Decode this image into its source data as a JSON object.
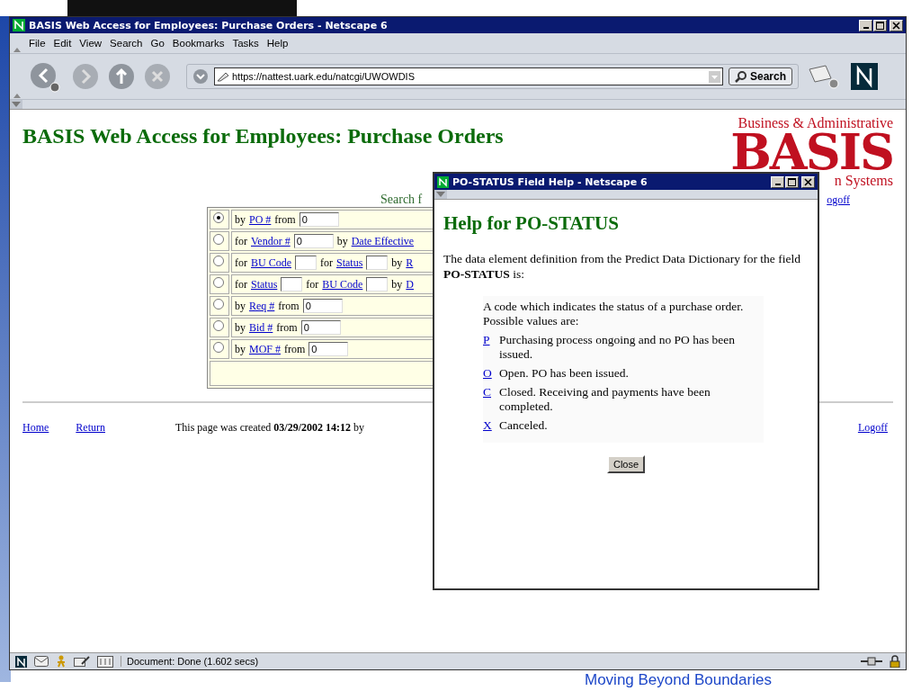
{
  "window": {
    "title": "BASIS Web Access for Employees: Purchase Orders - Netscape 6"
  },
  "menu": [
    "File",
    "Edit",
    "View",
    "Search",
    "Go",
    "Bookmarks",
    "Tasks",
    "Help"
  ],
  "toolbar": {
    "url": "https://nattest.uark.edu/natcgi/UWOWDIS",
    "search_button": "Search"
  },
  "page": {
    "heading": "BASIS Web Access for Employees: Purchase Orders",
    "logo": {
      "top": "Business & Administrative",
      "big": "BASIS",
      "bottom": "n Systems"
    },
    "search_label": "Search f",
    "logoff_top": "ogoff",
    "form_rows": [
      {
        "selected": true,
        "parts": [
          {
            "kind": "text",
            "text": "by"
          },
          {
            "kind": "link",
            "text": "PO #"
          },
          {
            "kind": "text",
            "text": "from"
          },
          {
            "kind": "input",
            "value": "0"
          }
        ]
      },
      {
        "selected": false,
        "parts": [
          {
            "kind": "text",
            "text": "for"
          },
          {
            "kind": "link",
            "text": "Vendor #"
          },
          {
            "kind": "input",
            "value": "0"
          },
          {
            "kind": "text",
            "text": "by"
          },
          {
            "kind": "link",
            "text": "Date Effective"
          }
        ]
      },
      {
        "selected": false,
        "parts": [
          {
            "kind": "text",
            "text": "for"
          },
          {
            "kind": "link",
            "text": "BU Code"
          },
          {
            "kind": "input"
          },
          {
            "kind": "text",
            "text": "for"
          },
          {
            "kind": "link",
            "text": "Status"
          },
          {
            "kind": "input"
          },
          {
            "kind": "text",
            "text": "by"
          },
          {
            "kind": "link",
            "text": "R"
          }
        ]
      },
      {
        "selected": false,
        "parts": [
          {
            "kind": "text",
            "text": "for"
          },
          {
            "kind": "link",
            "text": "Status"
          },
          {
            "kind": "input"
          },
          {
            "kind": "text",
            "text": "for"
          },
          {
            "kind": "link",
            "text": "BU Code"
          },
          {
            "kind": "input"
          },
          {
            "kind": "text",
            "text": "by"
          },
          {
            "kind": "link",
            "text": "D"
          }
        ]
      },
      {
        "selected": false,
        "parts": [
          {
            "kind": "text",
            "text": "by"
          },
          {
            "kind": "link",
            "text": "Req #"
          },
          {
            "kind": "text",
            "text": "from"
          },
          {
            "kind": "input",
            "value": "0"
          }
        ]
      },
      {
        "selected": false,
        "parts": [
          {
            "kind": "text",
            "text": "by"
          },
          {
            "kind": "link",
            "text": "Bid #"
          },
          {
            "kind": "text",
            "text": "from"
          },
          {
            "kind": "input",
            "value": "0"
          }
        ]
      },
      {
        "selected": false,
        "parts": [
          {
            "kind": "text",
            "text": "by"
          },
          {
            "kind": "link",
            "text": "MOF #"
          },
          {
            "kind": "text",
            "text": "from"
          },
          {
            "kind": "input",
            "value": "0"
          }
        ]
      }
    ],
    "footer": {
      "home": "Home",
      "return": "Return",
      "created": "This page was created **03/29/2002 14:12** by",
      "logoff": "Logoff"
    }
  },
  "popup": {
    "title": "PO-STATUS Field Help - Netscape 6",
    "heading": "Help for PO-STATUS",
    "intro": "The data element definition from the Predict Data Dictionary for the field **PO-STATUS** is:",
    "description": "A code which indicates the status of a purchase order. Possible values are:",
    "values": [
      {
        "code": "P",
        "text": "Purchasing process ongoing and no PO has been issued."
      },
      {
        "code": "O",
        "text": "Open. PO has been issued."
      },
      {
        "code": "C",
        "text": "Closed. Receiving and payments have been completed."
      },
      {
        "code": "X",
        "text": "Canceled."
      }
    ],
    "close_button": "Close"
  },
  "status_bar": {
    "text": "Document: Done (1.602 secs)"
  },
  "slide_footer": "Moving Beyond Boundaries"
}
